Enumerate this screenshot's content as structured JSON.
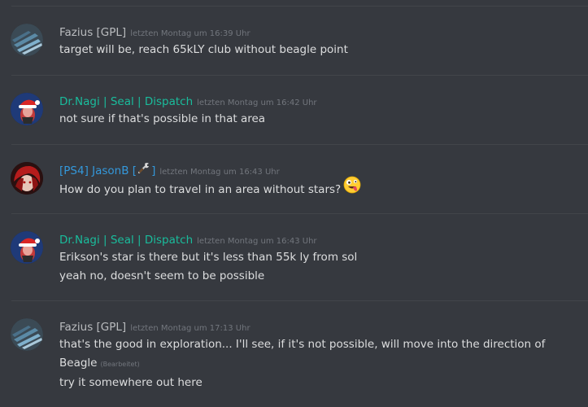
{
  "messages": [
    {
      "author": "Fazius [GPL]",
      "author_color": "#b9bbbe",
      "avatar_icon": "lines-avatar-icon",
      "timestamp": "letzten Montag um 16:39 Uhr",
      "lines": [
        "target will be, reach 65kLY club without beagle point"
      ]
    },
    {
      "author": "Dr.Nagi | Seal | Dispatch",
      "author_color": "#1abc9c",
      "avatar_icon": "santa-avatar-icon",
      "timestamp": "letzten Montag um 16:42 Uhr",
      "lines": [
        "not sure if that's possible in that area"
      ]
    },
    {
      "author_prefix": "[PS4] JasonB [",
      "author_suffix": "]",
      "author_icon": "wrench-icon",
      "author_color": "#3498db",
      "avatar_icon": "red-hair-avatar-icon",
      "timestamp": "letzten Montag um 16:43 Uhr",
      "lines": [
        "How do you plan to travel in an area without stars?"
      ],
      "emoji": "zany-face-emoji-icon"
    },
    {
      "author": "Dr.Nagi | Seal | Dispatch",
      "author_color": "#1abc9c",
      "avatar_icon": "santa-avatar-icon",
      "timestamp": "letzten Montag um 16:43 Uhr",
      "lines": [
        "Erikson's star is there but it's less than 55k ly from sol",
        "yeah no, doesn't seem to be possible"
      ]
    },
    {
      "author": "Fazius [GPL]",
      "author_color": "#b9bbbe",
      "avatar_icon": "lines-avatar-icon",
      "timestamp": "letzten Montag um 17:13 Uhr",
      "lines": [
        "that's the good in exploration... I'll see, if it's not possible, will move into the direction of",
        "Beagle",
        "try it somewhere out here"
      ],
      "edited_label": "(Bearbeitet)"
    }
  ],
  "colors": {
    "background": "#36393f",
    "divider": "#42454a",
    "message_text": "#dcddde",
    "timestamp": "#72767d"
  }
}
